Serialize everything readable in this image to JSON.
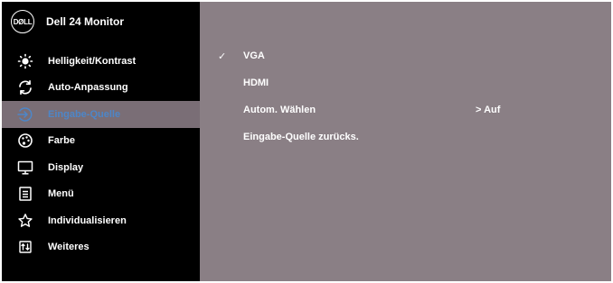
{
  "header": {
    "logo_text": "DØLL",
    "title": "Dell 24 Monitor"
  },
  "menu": {
    "items": [
      {
        "label": "Helligkeit/Kontrast",
        "icon": "brightness-icon",
        "active": false
      },
      {
        "label": "Auto-Anpassung",
        "icon": "auto-adjust-icon",
        "active": false
      },
      {
        "label": "Eingabe-Quelle",
        "icon": "input-source-icon",
        "active": true
      },
      {
        "label": "Farbe",
        "icon": "color-palette-icon",
        "active": false
      },
      {
        "label": "Display",
        "icon": "display-icon",
        "active": false
      },
      {
        "label": "Menü",
        "icon": "menu-icon",
        "active": false
      },
      {
        "label": "Individualisieren",
        "icon": "star-icon",
        "active": false
      },
      {
        "label": "Weiteres",
        "icon": "others-icon",
        "active": false
      }
    ]
  },
  "submenu": {
    "options": [
      {
        "label": "VGA",
        "checked": true,
        "value": ""
      },
      {
        "label": "HDMI",
        "checked": false,
        "value": ""
      },
      {
        "label": "Autom. Wählen",
        "checked": false,
        "value": "> Auf"
      },
      {
        "label": "Eingabe-Quelle zurücks.",
        "checked": false,
        "value": ""
      }
    ],
    "check_glyph": "✓"
  },
  "colors": {
    "sidebar_bg": "#000000",
    "content_bg": "#8a7f85",
    "active_bg": "#7a6e76",
    "active_text": "#4d86c8"
  }
}
